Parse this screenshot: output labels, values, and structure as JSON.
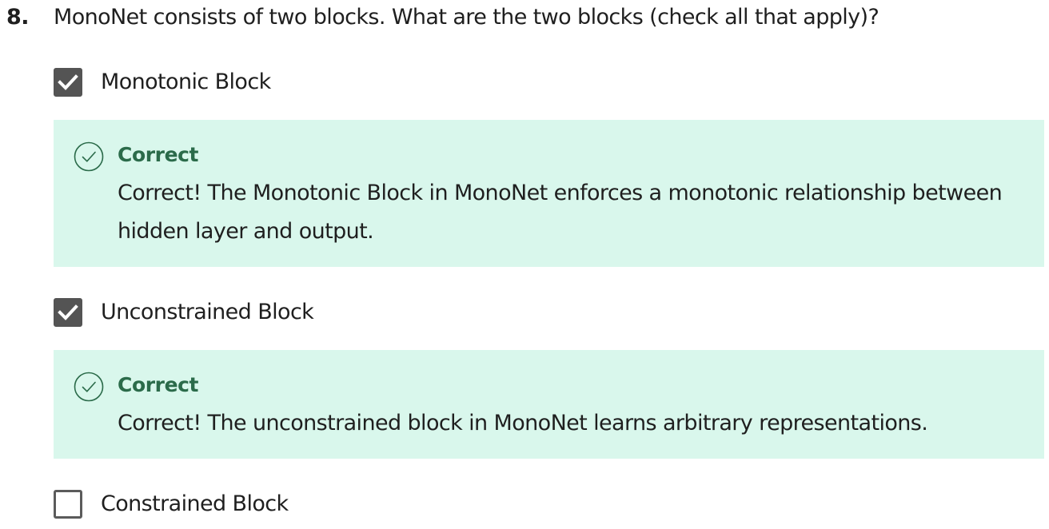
{
  "question": {
    "number": "8.",
    "text": "MonoNet consists of two blocks. What are the two blocks (check all that apply)?"
  },
  "options": [
    {
      "label": "Monotonic Block",
      "checked": true,
      "feedback": {
        "title": "Correct",
        "text": "Correct! The Monotonic Block in MonoNet enforces a monotonic relationship between hidden layer and output.",
        "icon": "check-circle-icon"
      }
    },
    {
      "label": "Unconstrained Block",
      "checked": true,
      "feedback": {
        "title": "Correct",
        "text": "Correct! The unconstrained block in MonoNet learns arbitrary representations.",
        "icon": "check-circle-icon"
      }
    },
    {
      "label": "Constrained Block",
      "checked": false
    }
  ],
  "colors": {
    "feedback_bg": "#d9f7ec",
    "feedback_title": "#2b6b4a",
    "checkbox_checked": "#545454"
  }
}
